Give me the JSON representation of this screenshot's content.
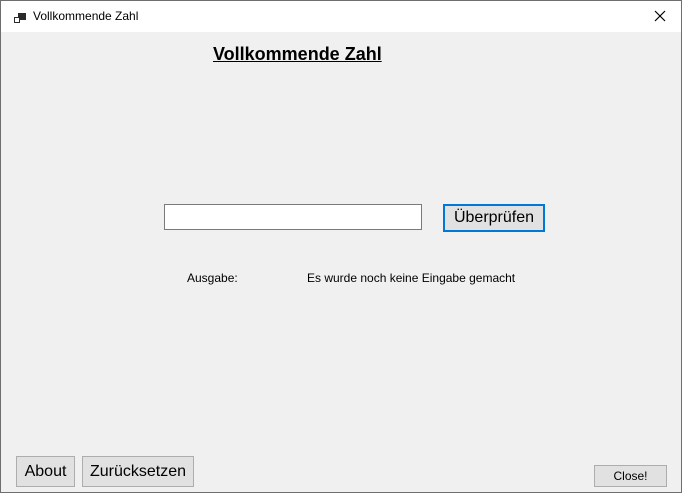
{
  "window": {
    "title": "Vollkommende Zahl",
    "app_icon": "app-window-icon",
    "close_icon": "close-icon"
  },
  "main": {
    "heading": "Vollkommende Zahl",
    "input": {
      "value": "",
      "placeholder": ""
    },
    "check_button_label": "Überprüfen",
    "output_label": "Ausgabe:",
    "output_value": "Es wurde noch keine Eingabe gemacht"
  },
  "footer": {
    "about_label": "About",
    "reset_label": "Zurücksetzen",
    "close_label": "Close!"
  },
  "colors": {
    "background": "#f0f0f0",
    "button_face": "#e1e1e1",
    "focus_border": "#0078d7"
  }
}
